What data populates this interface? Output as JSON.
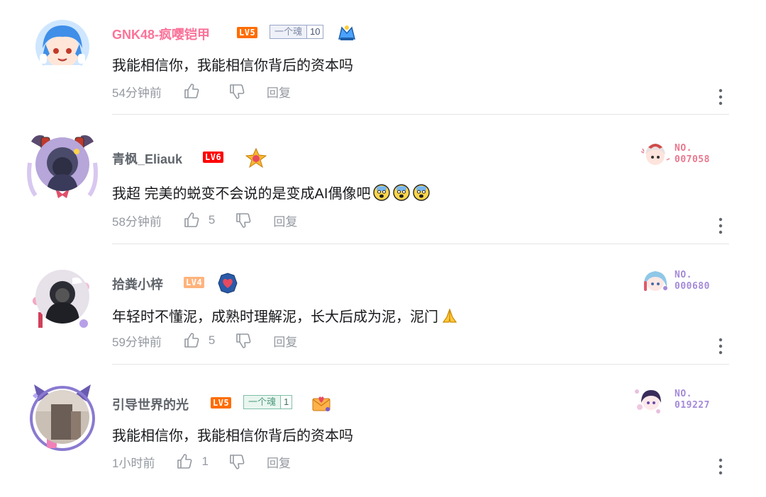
{
  "comments": [
    {
      "username": "GNK48-疯嘤铠甲",
      "level": "LV5",
      "fan_medal": {
        "name": "一个魂",
        "level": "10"
      },
      "content": "我能相信你，我能相信你背后的资本吗",
      "time": "54分钟前",
      "likes": "",
      "reply_label": "回复"
    },
    {
      "username": "青枫_Eliauk",
      "level": "LV6",
      "content": "我超 完美的蜕变不会说的是变成AI偶像吧",
      "emojis": [
        "scared-emoji",
        "scared-emoji",
        "scared-emoji"
      ],
      "time": "58分钟前",
      "likes": "5",
      "reply_label": "回复",
      "fan_card_no": "NO.\n007058",
      "fan_card_line1": "NO.",
      "fan_card_line2": "007058"
    },
    {
      "username": "拾粪小梓",
      "level": "LV4",
      "content": "年轻时不懂泥，成熟时理解泥，长大后成为泥，泥门",
      "emojis": [
        "pray-emoji"
      ],
      "time": "59分钟前",
      "likes": "5",
      "reply_label": "回复",
      "fan_card_line1": "NO.",
      "fan_card_line2": "000680"
    },
    {
      "username": "引导世界的光",
      "level": "LV5",
      "fan_medal": {
        "name": "一个魂",
        "level": "1"
      },
      "content": "我能相信你，我能相信你背后的资本吗",
      "time": "1小时前",
      "likes": "1",
      "reply_label": "回复",
      "fan_card_line1": "NO.",
      "fan_card_line2": "019227"
    }
  ],
  "colors": {
    "vip_name": "#fb7299",
    "normal_name": "#61666d",
    "meta": "#9499a0",
    "text": "#18191c",
    "divider": "#e3e5e7",
    "card_pink": "#e8788e",
    "card_purple": "#a58ad9"
  }
}
